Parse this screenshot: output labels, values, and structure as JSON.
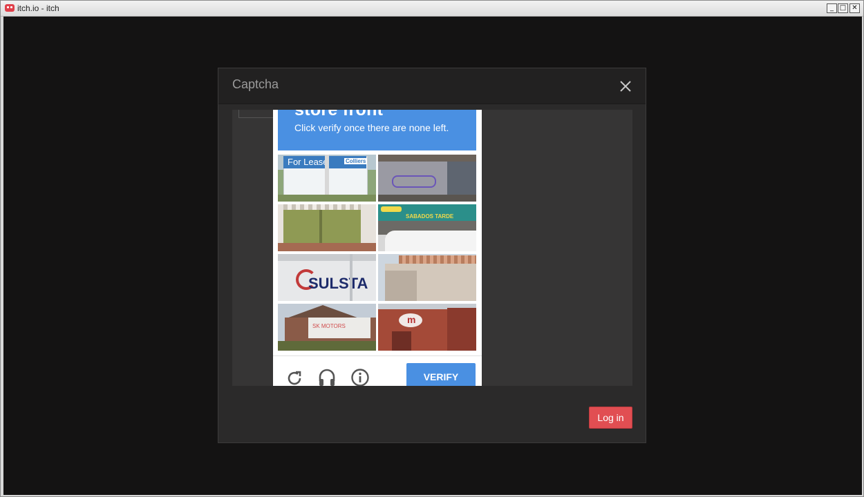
{
  "window": {
    "title": "itch.io - itch",
    "min_glyph": "_",
    "max_glyph": "□",
    "close_glyph": "✕"
  },
  "modal": {
    "title": "Captcha",
    "close_icon": "close-icon"
  },
  "captcha": {
    "heading": "store front",
    "instruction": "Click verify once there are none left.",
    "accent_color": "#4a90e2",
    "tiles": [
      {
        "text": "For Lease",
        "subtext": "Colliers"
      },
      {
        "text": ""
      },
      {
        "text": ""
      },
      {
        "text": "SABADOS TARDE"
      },
      {
        "text": "SULSTA"
      },
      {
        "text": ""
      },
      {
        "text": "SK MOTORS"
      },
      {
        "text": "m"
      }
    ],
    "footer": {
      "reload_icon": "reload-icon",
      "audio_icon": "headphones-icon",
      "info_icon": "info-icon",
      "verify_label": "VERIFY"
    }
  },
  "actions": {
    "login_label": "Log in",
    "login_color": "#e14e52"
  }
}
